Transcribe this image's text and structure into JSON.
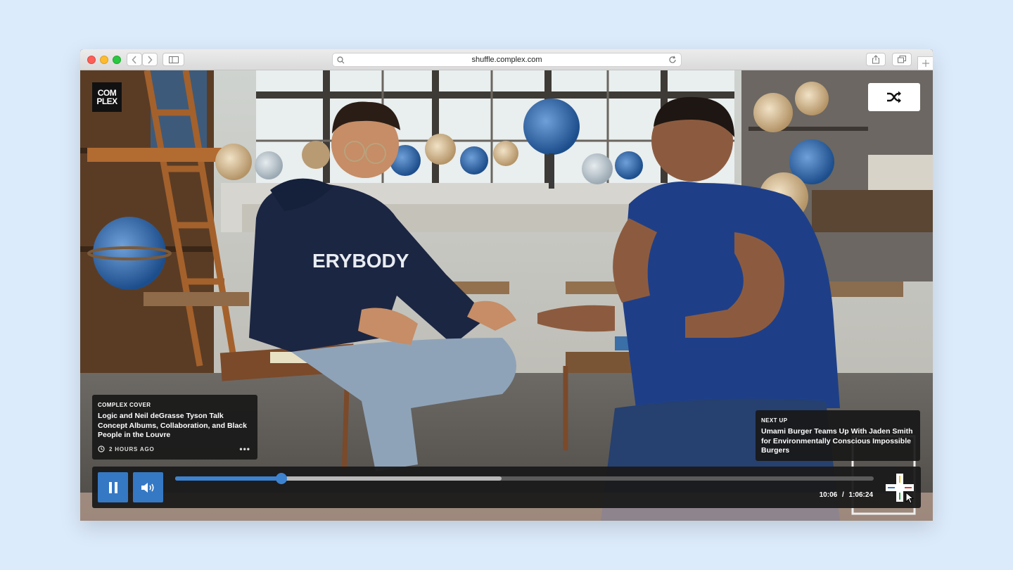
{
  "browser": {
    "url": "shuffle.complex.com"
  },
  "brand": {
    "logo_line1": "COM",
    "logo_line2": "PLEX"
  },
  "now_playing": {
    "category": "COMPLEX COVER",
    "title": "Logic and Neil deGrasse Tyson Talk Concept Albums, Collaboration, and Black People in the Louvre",
    "posted": "2 HOURS AGO",
    "more_label": "•••"
  },
  "next_up": {
    "label": "NEXT UP",
    "title": "Umami Burger Teams Up With Jaden Smith for Environmentally Conscious Impossible Burgers"
  },
  "player": {
    "current_time": "10:06",
    "separator": "/",
    "duration": "1:06:24",
    "progress_fraction": 0.152,
    "buffered_fraction": 0.467,
    "accent_color": "#3579c5"
  },
  "scene": {
    "hoodie_text": "ERYBODY"
  },
  "icons": [
    "back-icon",
    "forward-icon",
    "sidebar-icon",
    "search-icon",
    "reload-icon",
    "share-icon",
    "tabs-icon",
    "new-tab-icon",
    "shuffle-icon",
    "pause-icon",
    "volume-icon",
    "clock-icon",
    "add-icon"
  ]
}
